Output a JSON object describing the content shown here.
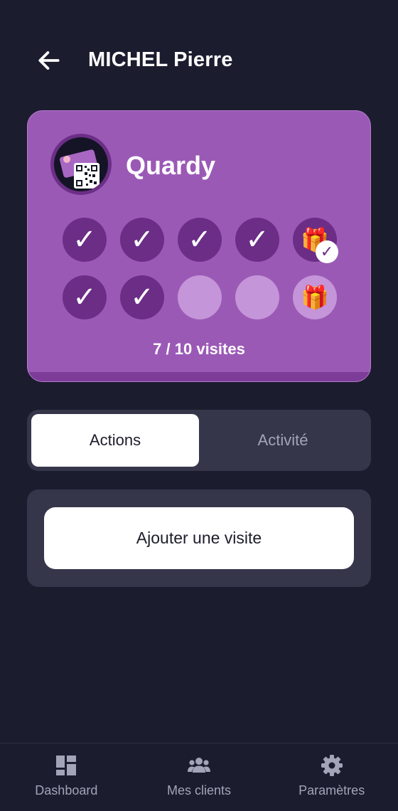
{
  "header": {
    "title": "MICHEL Pierre",
    "back_icon": "arrow-left-icon"
  },
  "card": {
    "brand_name": "Quardy",
    "logo_icon": "loyalty-card-qr-icon",
    "colors": {
      "background": "#9b59b6",
      "stamp_done": "#6b2d86",
      "stamp_empty": "#c495d8"
    },
    "stamps": {
      "row1": [
        "✓",
        "✓",
        "✓",
        "✓",
        "🎁"
      ],
      "row2": [
        "✓",
        "✓",
        "",
        "",
        "🎁"
      ],
      "gift_claimed_badge": "✓"
    },
    "visits_completed": 7,
    "visits_total": 10,
    "visit_count_text": "7 / 10 visites"
  },
  "tabs": {
    "actions": "Actions",
    "activity": "Activité",
    "selected": "Actions"
  },
  "actions_panel": {
    "add_visit_label": "Ajouter une visite"
  },
  "bottom_nav": {
    "dashboard": {
      "label": "Dashboard",
      "icon": "dashboard-icon"
    },
    "clients": {
      "label": "Mes clients",
      "icon": "users-icon"
    },
    "settings": {
      "label": "Paramètres",
      "icon": "gear-icon"
    }
  }
}
